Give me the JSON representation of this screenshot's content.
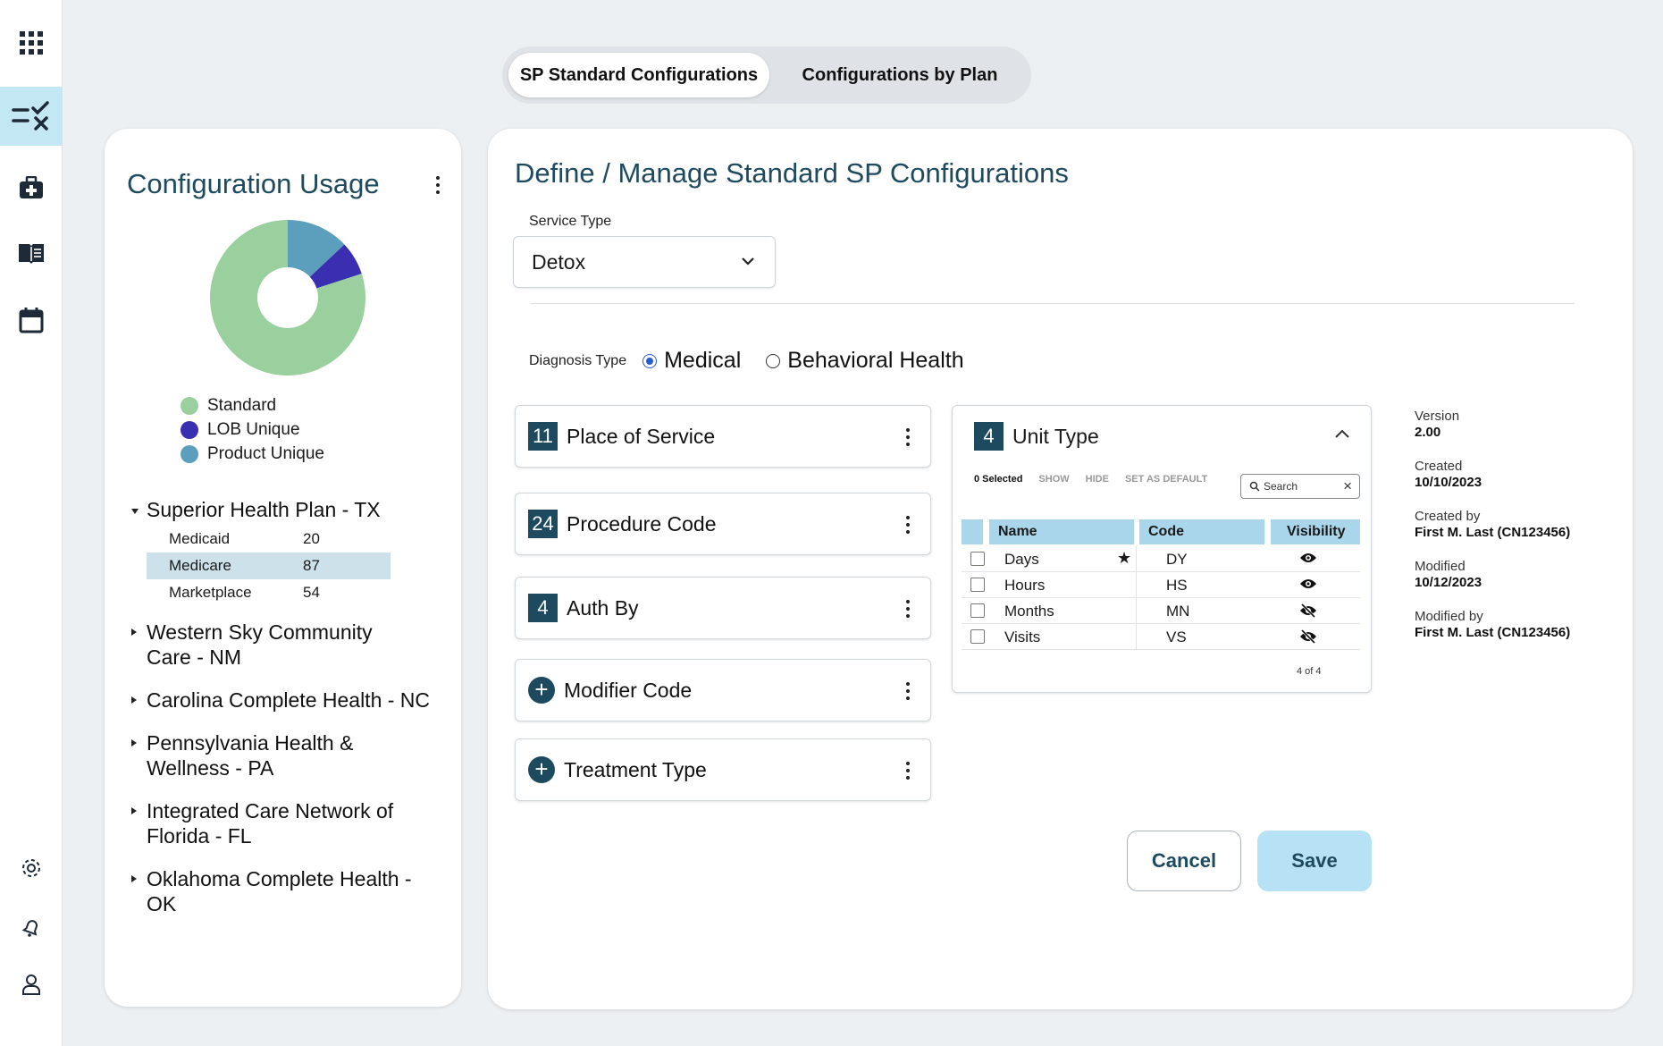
{
  "nav": {
    "items": [
      "apps",
      "checklist",
      "medical-kit",
      "book",
      "calendar"
    ],
    "bottom": [
      "settings",
      "notifications",
      "profile"
    ],
    "active": "checklist"
  },
  "tabs": {
    "selected": "SP Standard Configurations",
    "other": "Configurations by Plan"
  },
  "usage": {
    "title": "Configuration Usage",
    "legend": [
      {
        "label": "Standard",
        "color": "#9acf9e",
        "value": 0.8
      },
      {
        "label": "LOB Unique",
        "color": "#3a2fb0",
        "value": 0.07
      },
      {
        "label": "Product Unique",
        "color": "#5c9fbd",
        "value": 0.13
      }
    ],
    "plans": [
      {
        "name": "Superior Health Plan - TX",
        "expanded": true,
        "lobs": [
          {
            "name": "Medicaid",
            "count": "20"
          },
          {
            "name": "Medicare",
            "count": "87"
          },
          {
            "name": "Marketplace",
            "count": "54"
          }
        ]
      },
      {
        "name_line1": "Western Sky Community",
        "name_line2": "Care - NM"
      },
      {
        "name": "Carolina Complete Health - NC"
      },
      {
        "name_line1": "Pennsylvania Health &",
        "name_line2": "Wellness - PA"
      },
      {
        "name_line1": "Integrated Care Network of",
        "name_line2": "Florida - FL"
      },
      {
        "name_line1": "Oklahoma Complete Health -",
        "name_line2": "OK"
      }
    ]
  },
  "main": {
    "title": "Define / Manage Standard SP Configurations",
    "service_type_label": "Service Type",
    "service_type_value": "Detox",
    "diagnosis_label": "Diagnosis Type",
    "diagnosis_options": [
      "Medical",
      "Behavioral Health"
    ],
    "diagnosis_selected": "Medical",
    "configs": [
      {
        "count": "11",
        "label": "Place of Service"
      },
      {
        "count": "24",
        "label": "Procedure Code"
      },
      {
        "count": "4",
        "label": "Auth By"
      },
      {
        "count": "",
        "label": "Modifier Code"
      },
      {
        "count": "",
        "label": "Treatment Type"
      }
    ],
    "unit_type": {
      "count": "4",
      "label": "Unit Type",
      "selected_text": "0 Selected",
      "show": "SHOW",
      "hide": "HIDE",
      "set_default": "SET AS DEFAULT",
      "search_placeholder": "Search",
      "columns": [
        "Name",
        "Code",
        "Visibility"
      ],
      "rows": [
        {
          "name": "Days",
          "code": "DY",
          "visible": true,
          "default": true
        },
        {
          "name": "Hours",
          "code": "HS",
          "visible": true,
          "default": false
        },
        {
          "name": "Months",
          "code": "MN",
          "visible": false,
          "default": false
        },
        {
          "name": "Visits",
          "code": "VS",
          "visible": false,
          "default": false
        }
      ],
      "pager": "4 of 4"
    },
    "meta": [
      {
        "key": "Version",
        "value": "2.00"
      },
      {
        "key": "Created",
        "value": "10/10/2023"
      },
      {
        "key": "Created by",
        "value": "First M. Last (CN123456)"
      },
      {
        "key": "Modified",
        "value": "10/12/2023"
      },
      {
        "key": "Modified by",
        "value": "First M. Last (CN123456)"
      }
    ],
    "cancel_label": "Cancel",
    "save_label": "Save"
  }
}
